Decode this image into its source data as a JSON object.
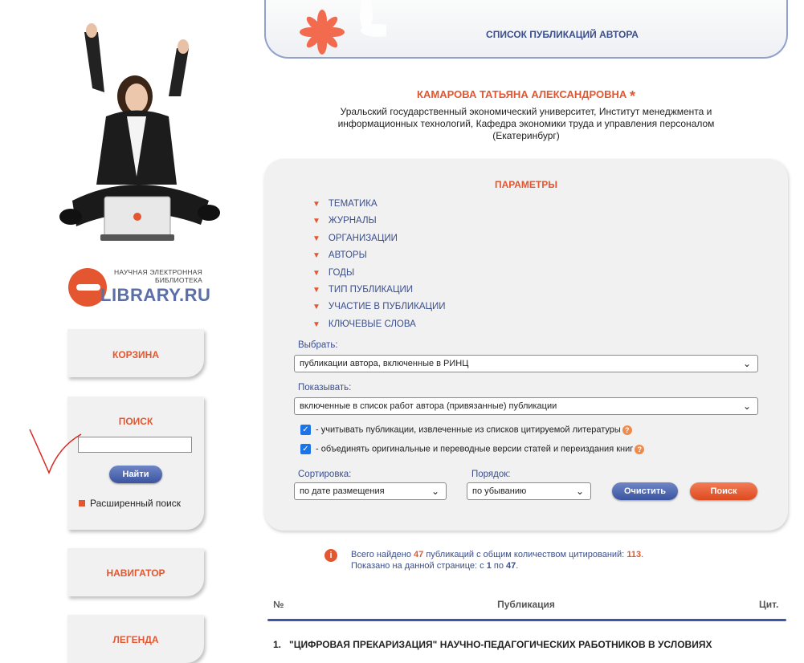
{
  "header": {
    "title": "СПИСОК ПУБЛИКАЦИЙ АВТОРА"
  },
  "logo": {
    "line1": "НАУЧНАЯ ЭЛЕКТРОННАЯ",
    "line2": "БИБЛИОТЕКА",
    "brand": "LIBRARY.RU"
  },
  "sidebar": {
    "cart": "КОРЗИНА",
    "search": {
      "title": "ПОИСК",
      "input_value": "",
      "button": "Найти",
      "advanced": "Расширенный поиск"
    },
    "navigator": "НАВИГАТОР",
    "legend": "ЛЕГЕНДА"
  },
  "author": {
    "name": "КАМАРОВА ТАТЬЯНА АЛЕКСАНДРОВНА",
    "star": "*",
    "affiliation": "Уральский государственный экономический университет, Институт менеджмента и информационных технологий, Кафедра экономики труда и управления персоналом (Екатеринбург)"
  },
  "params": {
    "title": "ПАРАМЕТРЫ",
    "items": [
      "ТЕМАТИКА",
      "ЖУРНАЛЫ",
      "ОРГАНИЗАЦИИ",
      "АВТОРЫ",
      "ГОДЫ",
      "ТИП ПУБЛИКАЦИИ",
      "УЧАСТИЕ В ПУБЛИКАЦИИ",
      "КЛЮЧЕВЫЕ СЛОВА"
    ],
    "select_label": "Выбрать:",
    "select_value": "публикации автора, включенные в РИНЦ",
    "show_label": "Показывать:",
    "show_value": "включенные в список работ автора (привязанные) публикации",
    "check1": "- учитывать публикации, извлеченные из списков цитируемой литературы",
    "check2": "- объединять оригинальные и переводные версии статей и переиздания книг",
    "sort_label": "Сортировка:",
    "sort_value": "по дате размещения",
    "order_label": "Порядок:",
    "order_value": "по убыванию",
    "clear_button": "Очистить",
    "search_button": "Поиск"
  },
  "summary": {
    "found_prefix": "Всего найдено",
    "found_count": "47",
    "found_middle": "публикаций с общим количеством цитирований:",
    "citations": "113",
    "shown_prefix": "Показано на данной странице: с",
    "shown_from": "1",
    "shown_to_word": "по",
    "shown_to": "47"
  },
  "table": {
    "col_no": "№",
    "col_pub": "Публикация",
    "col_cit": "Цит.",
    "rows": [
      {
        "n": "1.",
        "title": "\"ЦИФРОВАЯ ПРЕКАРИЗАЦИЯ\" НАУЧНО-ПЕДАГОГИЧЕСКИХ РАБОТНИКОВ В УСЛОВИЯХ"
      }
    ]
  },
  "colors": {
    "accent": "#e4562f",
    "brand_blue": "#3b4f8c",
    "divider": "#3d56a6"
  }
}
